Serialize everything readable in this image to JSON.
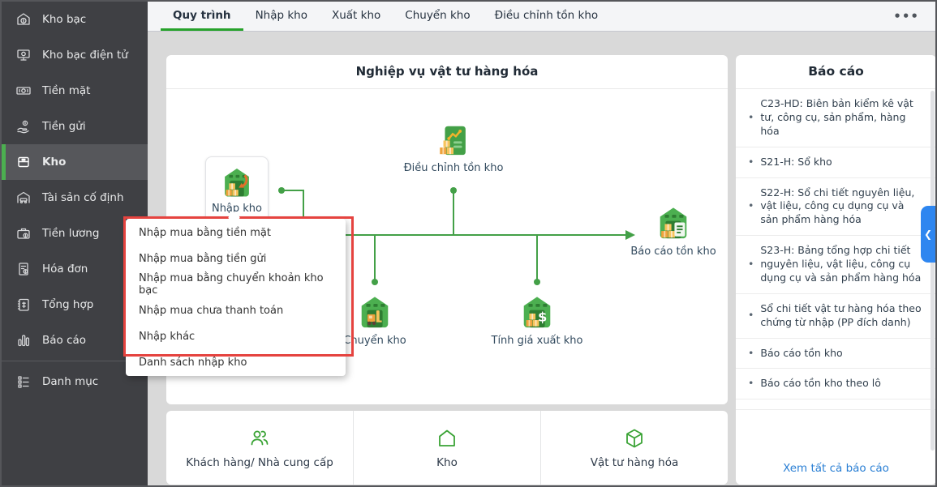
{
  "sidebar": {
    "items": [
      {
        "label": "Kho bạc"
      },
      {
        "label": "Kho bạc điện tử"
      },
      {
        "label": "Tiền mặt"
      },
      {
        "label": "Tiền gửi"
      },
      {
        "label": "Kho",
        "active": true
      },
      {
        "label": "Tài sản cố định"
      },
      {
        "label": "Tiền lương"
      },
      {
        "label": "Hóa đơn"
      },
      {
        "label": "Tổng hợp"
      },
      {
        "label": "Báo cáo"
      },
      {
        "label": "Danh mục"
      }
    ]
  },
  "tabs": {
    "items": [
      {
        "label": "Quy trình",
        "active": true
      },
      {
        "label": "Nhập kho"
      },
      {
        "label": "Xuất kho"
      },
      {
        "label": "Chuyển kho"
      },
      {
        "label": "Điều chỉnh tồn kho"
      }
    ],
    "more_label": "•••"
  },
  "diagram": {
    "title": "Nghiệp vụ vật tư hàng hóa",
    "nodes": {
      "nhap_kho": "Nhập kho",
      "dieu_chinh": "Điều chỉnh tồn kho",
      "chuyen_kho": "Chuyển kho",
      "tinh_gia": "Tính giá xuất kho",
      "bao_cao": "Báo cáo tồn kho"
    }
  },
  "dropdown": {
    "items": [
      {
        "label": "Nhập mua bằng tiền mặt"
      },
      {
        "label": "Nhập mua bằng tiền gửi"
      },
      {
        "label": "Nhập mua bằng chuyển khoản kho bạc"
      },
      {
        "label": "Nhập mua chưa thanh toán"
      },
      {
        "label": "Nhập khác"
      },
      {
        "label": "Danh sách nhập kho"
      }
    ]
  },
  "bottom_bar": {
    "items": [
      {
        "label": "Khách hàng/ Nhà cung cấp"
      },
      {
        "label": "Kho"
      },
      {
        "label": "Vật tư hàng hóa"
      }
    ]
  },
  "reports": {
    "title": "Báo cáo",
    "items": [
      {
        "label": "C23-HD: Biên bản kiểm kê vật tư, công cụ, sản phẩm, hàng hóa"
      },
      {
        "label": "S21-H: Sổ kho"
      },
      {
        "label": "S22-H: Sổ chi tiết nguyên liệu, vật liệu, công cụ dụng cụ và sản phẩm hàng hóa"
      },
      {
        "label": "S23-H: Bảng tổng hợp chi tiết nguyên liệu, vật liệu, công cụ dụng cụ và sản phẩm hàng hóa"
      },
      {
        "label": "Sổ chi tiết vật tư hàng hóa theo chứng từ nhập (PP đích danh)"
      },
      {
        "label": "Báo cáo tồn kho"
      },
      {
        "label": "Báo cáo tồn kho theo lô"
      }
    ],
    "footer_link": "Xem tất cả báo cáo",
    "collapse_chevron": "❮"
  },
  "colors": {
    "accent_green": "#4caf50",
    "flow_line_green": "#43a047",
    "sidebar_dark": "#3f4044",
    "highlight_red": "#e5433f",
    "link_blue": "#2a7fd4",
    "collapse_tab_blue": "#2e86f0"
  }
}
